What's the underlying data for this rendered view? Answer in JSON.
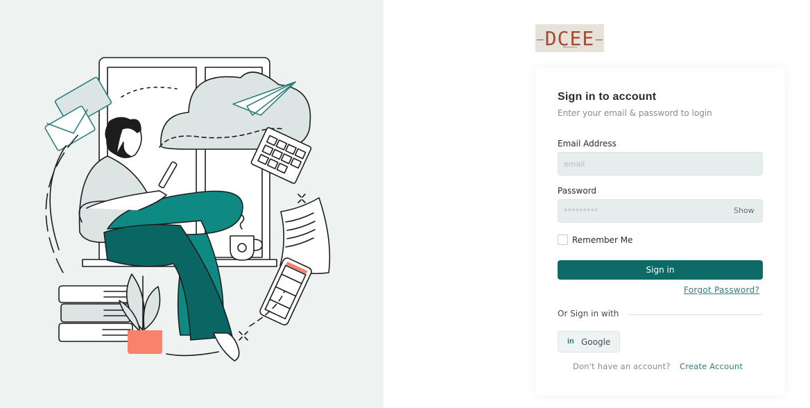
{
  "logo": {
    "text": "DCEE"
  },
  "login": {
    "title": "Sign in to account",
    "subtitle": "Enter your email & password to login",
    "email_label": "Email Address",
    "email_placeholder": "email",
    "password_label": "Password",
    "password_placeholder": "*********",
    "show_label": "Show",
    "remember_label": "Remember Me",
    "remember_checked": false,
    "signin_label": "Sign in",
    "forgot_label": "Forgot Password?",
    "or_label": "Or Sign in with",
    "social_label": "Google",
    "no_account_label": "Don't have an account?",
    "create_label": "Create Account"
  },
  "colors": {
    "primary": "#0e6a66",
    "left_bg": "#eef3f2",
    "accent": "#2e7e79",
    "pot": "#f9826a",
    "pants": "#0e8a82",
    "pants_dark": "#0a5e59"
  }
}
